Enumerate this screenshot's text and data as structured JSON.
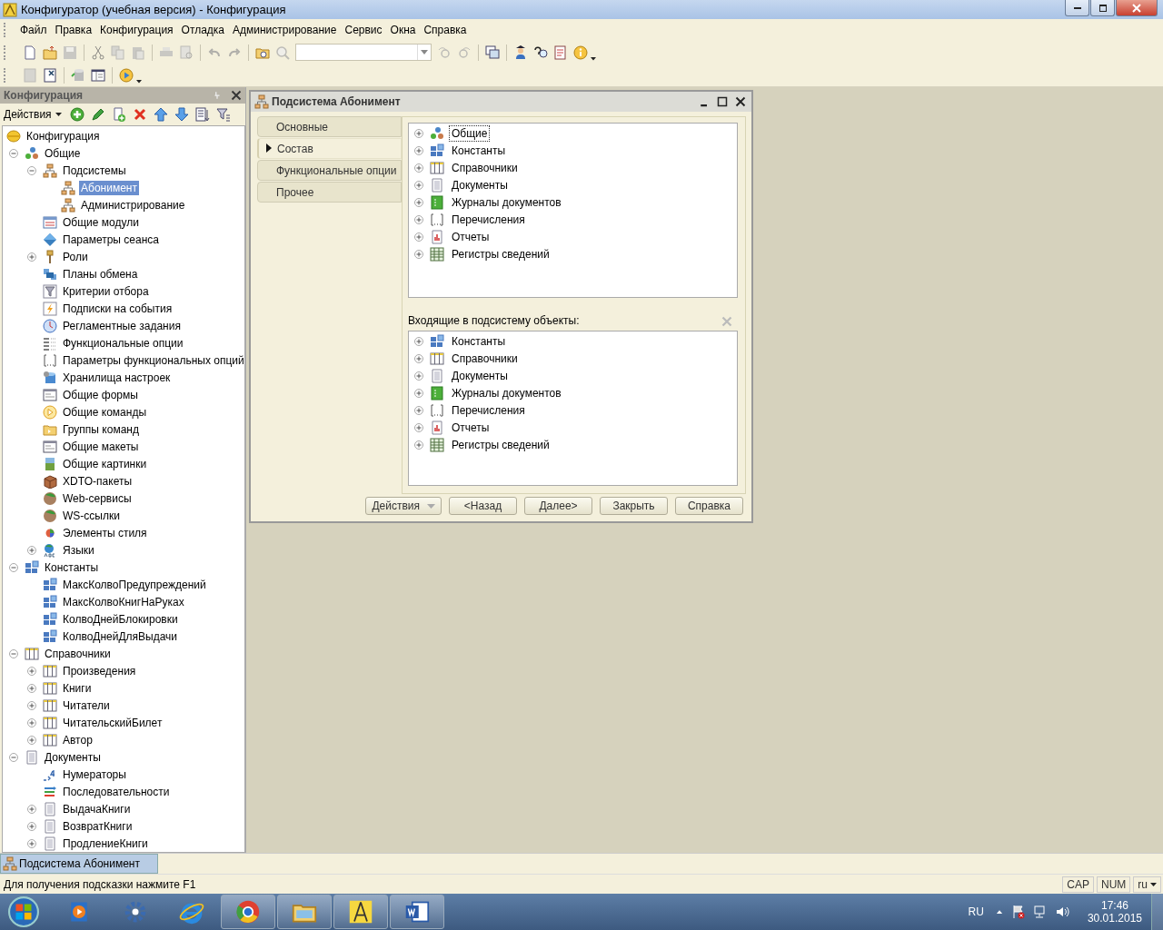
{
  "window": {
    "title": "Конфигуратор (учебная версия) - Конфигурация"
  },
  "menu": [
    "Файл",
    "Правка",
    "Конфигурация",
    "Отладка",
    "Администрирование",
    "Сервис",
    "Окна",
    "Справка"
  ],
  "config_panel": {
    "title": "Конфигурация",
    "actions_label": "Действия",
    "tree": [
      {
        "label": "Конфигурация",
        "kind": "config",
        "selected": false,
        "children": [
          {
            "label": "Общие",
            "kind": "common",
            "expanded": true,
            "selected": false,
            "children": [
              {
                "label": "Подсистемы",
                "kind": "subsystem",
                "expanded": true,
                "selected": false,
                "children": [
                  {
                    "label": "Абонимент",
                    "kind": "subsystem",
                    "selected": true
                  },
                  {
                    "label": "Администрирование",
                    "kind": "subsystem",
                    "selected": false
                  }
                ]
              },
              {
                "label": "Общие модули",
                "kind": "module",
                "selected": false
              },
              {
                "label": "Параметры сеанса",
                "kind": "session",
                "selected": false
              },
              {
                "label": "Роли",
                "kind": "role",
                "expanded": false,
                "selected": false
              },
              {
                "label": "Планы обмена",
                "kind": "exchange",
                "selected": false
              },
              {
                "label": "Критерии отбора",
                "kind": "filter",
                "selected": false
              },
              {
                "label": "Подписки на события",
                "kind": "subscription",
                "selected": false
              },
              {
                "label": "Регламентные задания",
                "kind": "scheduled",
                "selected": false
              },
              {
                "label": "Функциональные опции",
                "kind": "option",
                "selected": false
              },
              {
                "label": "Параметры функциональных опций",
                "kind": "enum",
                "selected": false
              },
              {
                "label": "Хранилища настроек",
                "kind": "storage",
                "selected": false
              },
              {
                "label": "Общие формы",
                "kind": "form",
                "selected": false
              },
              {
                "label": "Общие команды",
                "kind": "command",
                "selected": false
              },
              {
                "label": "Группы команд",
                "kind": "folder",
                "selected": false
              },
              {
                "label": "Общие макеты",
                "kind": "form",
                "selected": false
              },
              {
                "label": "Общие картинки",
                "kind": "picture",
                "selected": false
              },
              {
                "label": "XDTO-пакеты",
                "kind": "package",
                "selected": false
              },
              {
                "label": "Web-сервисы",
                "kind": "globe",
                "selected": false
              },
              {
                "label": "WS-ссылки",
                "kind": "globe",
                "selected": false
              },
              {
                "label": "Элементы стиля",
                "kind": "style",
                "selected": false
              },
              {
                "label": "Языки",
                "kind": "language",
                "expanded": false,
                "selected": false
              }
            ]
          },
          {
            "label": "Константы",
            "kind": "constant",
            "expanded": true,
            "selected": false,
            "children": [
              {
                "label": "МаксКолвоПредупреждений",
                "kind": "constant",
                "selected": false
              },
              {
                "label": "МаксКолвоКнигНаРуках",
                "kind": "constant",
                "selected": false
              },
              {
                "label": "КолвоДнейБлокировки",
                "kind": "constant",
                "selected": false
              },
              {
                "label": "КолвоДнейДляВыдачи",
                "kind": "constant",
                "selected": false
              }
            ]
          },
          {
            "label": "Справочники",
            "kind": "catalog",
            "expanded": true,
            "selected": false,
            "children": [
              {
                "label": "Произведения",
                "kind": "catalog",
                "expanded": false,
                "selected": false
              },
              {
                "label": "Книги",
                "kind": "catalog",
                "expanded": false,
                "selected": false
              },
              {
                "label": "Читатели",
                "kind": "catalog",
                "expanded": false,
                "selected": false
              },
              {
                "label": "ЧитательскийБилет",
                "kind": "catalog",
                "expanded": false,
                "selected": false
              },
              {
                "label": "Автор",
                "kind": "catalog",
                "expanded": false,
                "selected": false
              }
            ]
          },
          {
            "label": "Документы",
            "kind": "document",
            "expanded": true,
            "selected": false,
            "children": [
              {
                "label": "Нумераторы",
                "kind": "numerator",
                "selected": false
              },
              {
                "label": "Последовательности",
                "kind": "sequence",
                "selected": false
              },
              {
                "label": "ВыдачаКниги",
                "kind": "document",
                "expanded": false,
                "selected": false
              },
              {
                "label": "ВозвратКниги",
                "kind": "document",
                "expanded": false,
                "selected": false
              },
              {
                "label": "ПродлениеКниги",
                "kind": "document",
                "expanded": false,
                "selected": false
              }
            ]
          }
        ]
      }
    ]
  },
  "dialog": {
    "title": "Подсистема Абонимент",
    "tabs": [
      {
        "label": "Основные",
        "selected": false
      },
      {
        "label": "Состав",
        "selected": true
      },
      {
        "label": "Функциональные опции",
        "selected": false
      },
      {
        "label": "Прочее",
        "selected": false
      }
    ],
    "all_objects": [
      {
        "label": "Общие",
        "kind": "common",
        "expanded": false,
        "selected": true
      },
      {
        "label": "Константы",
        "kind": "constant",
        "expanded": false,
        "selected": false
      },
      {
        "label": "Справочники",
        "kind": "catalog",
        "expanded": false,
        "selected": false
      },
      {
        "label": "Документы",
        "kind": "document",
        "expanded": false,
        "selected": false
      },
      {
        "label": "Журналы документов",
        "kind": "journal",
        "expanded": false,
        "selected": false
      },
      {
        "label": "Перечисления",
        "kind": "enum",
        "expanded": false,
        "selected": false
      },
      {
        "label": "Отчеты",
        "kind": "report",
        "expanded": false,
        "selected": false
      },
      {
        "label": "Регистры сведений",
        "kind": "register",
        "expanded": false,
        "selected": false
      }
    ],
    "included_label": "Входящие в подсистему объекты:",
    "included_objects": [
      {
        "label": "Константы",
        "kind": "constant",
        "expanded": false,
        "selected": false
      },
      {
        "label": "Справочники",
        "kind": "catalog",
        "expanded": false,
        "selected": false
      },
      {
        "label": "Документы",
        "kind": "document",
        "expanded": false,
        "selected": false
      },
      {
        "label": "Журналы документов",
        "kind": "journal",
        "expanded": false,
        "selected": false
      },
      {
        "label": "Перечисления",
        "kind": "enum",
        "expanded": false,
        "selected": false
      },
      {
        "label": "Отчеты",
        "kind": "report",
        "expanded": false,
        "selected": false
      },
      {
        "label": "Регистры сведений",
        "kind": "register",
        "expanded": false,
        "selected": false
      }
    ],
    "buttons": [
      {
        "label": "Действия",
        "kind": "dropdown"
      },
      {
        "label": "<Назад",
        "kind": "plain"
      },
      {
        "label": "Далее>",
        "kind": "plain"
      },
      {
        "label": "Закрыть",
        "kind": "plain"
      },
      {
        "label": "Справка",
        "kind": "plain"
      }
    ]
  },
  "window_tabs": [
    {
      "label": "Подсистема Абонимент",
      "selected": true
    }
  ],
  "status_bar": {
    "hint": "Для получения подсказки нажмите F1",
    "indicators": [
      "CAP",
      "NUM"
    ],
    "language": "ru"
  },
  "taskbar": {
    "language": "RU",
    "time": "17:46",
    "date": "30.01.2015"
  }
}
